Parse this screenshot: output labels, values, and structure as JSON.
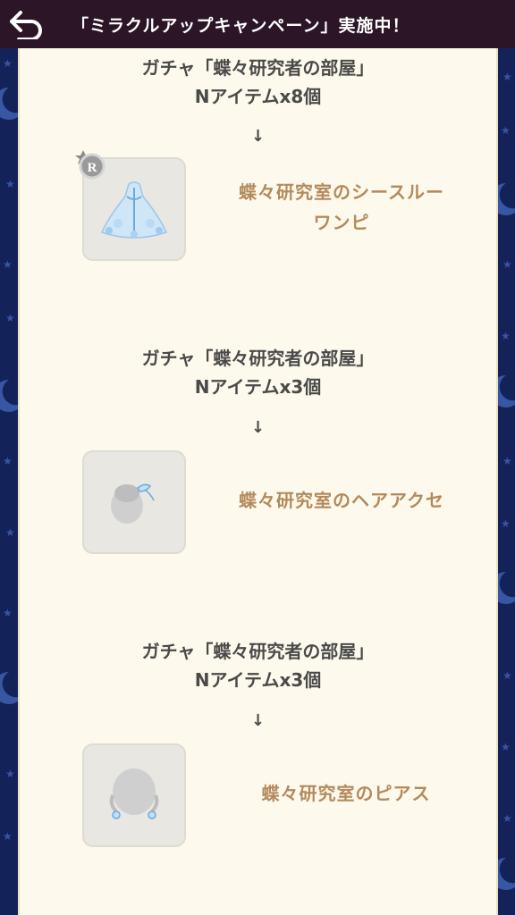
{
  "header": {
    "title": "「ミラクルアップキャンペーン」実施中！"
  },
  "rewards": [
    {
      "condition_line1": "ガチャ「蝶々研究者の部屋」",
      "condition_line2": "Nアイテムx8個",
      "arrow": "↓",
      "rarity": "R",
      "item_name_line1": "蝶々研究室のシースルー",
      "item_name_line2": "ワンピ",
      "icon": "dress-icon"
    },
    {
      "condition_line1": "ガチャ「蝶々研究者の部屋」",
      "condition_line2": "Nアイテムx3個",
      "arrow": "↓",
      "item_name_line1": "蝶々研究室のヘアアクセ",
      "icon": "hair-accessory-icon"
    },
    {
      "condition_line1": "ガチャ「蝶々研究者の部屋」",
      "condition_line2": "Nアイテムx3個",
      "arrow": "↓",
      "item_name_line1": "蝶々研究室のピアス",
      "icon": "earrings-icon"
    }
  ],
  "colors": {
    "header_bg": "#2b1526",
    "side_bg": "#14225a",
    "panel_bg": "#fdf9ec",
    "item_name": "#b48a5c",
    "condition_text": "#4a4a4a"
  }
}
